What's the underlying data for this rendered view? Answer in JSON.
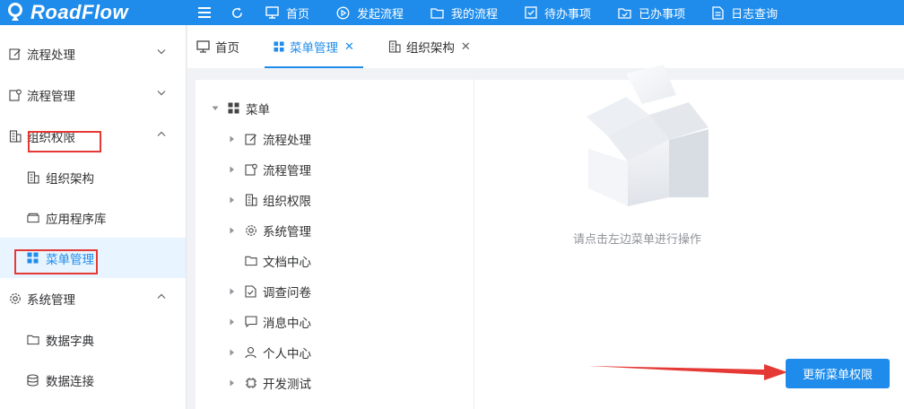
{
  "app": {
    "logo_text": "RoadFlow",
    "brand_color": "#1f8ceb",
    "highlight_color": "#e53935"
  },
  "topnav": [
    {
      "label": "首页",
      "icon": "monitor-icon"
    },
    {
      "label": "发起流程",
      "icon": "play-circle-icon"
    },
    {
      "label": "我的流程",
      "icon": "folder-icon"
    },
    {
      "label": "待办事项",
      "icon": "check-square-icon"
    },
    {
      "label": "已办事项",
      "icon": "folder-check-icon"
    },
    {
      "label": "日志查询",
      "icon": "document-icon"
    }
  ],
  "sidebar": {
    "groups": [
      {
        "label": "流程处理",
        "icon": "edit-icon",
        "expanded": false
      },
      {
        "label": "流程管理",
        "icon": "settings-doc-icon",
        "expanded": false
      },
      {
        "label": "组织权限",
        "icon": "building-icon",
        "expanded": true,
        "children": [
          {
            "label": "组织架构",
            "icon": "building-icon"
          },
          {
            "label": "应用程序库",
            "icon": "window-stack-icon"
          },
          {
            "label": "菜单管理",
            "icon": "grid-icon",
            "active": true
          }
        ]
      },
      {
        "label": "系统管理",
        "icon": "gear-icon",
        "expanded": true,
        "children": [
          {
            "label": "数据字典",
            "icon": "folder-icon"
          },
          {
            "label": "数据连接",
            "icon": "database-icon"
          }
        ]
      }
    ]
  },
  "tabs": [
    {
      "label": "首页",
      "icon": "monitor-icon",
      "closable": false
    },
    {
      "label": "菜单管理",
      "icon": "grid-icon",
      "closable": true,
      "active": true
    },
    {
      "label": "组织架构",
      "icon": "building-icon",
      "closable": true
    }
  ],
  "tree": {
    "root": "菜单",
    "children": [
      {
        "label": "流程处理",
        "icon": "edit-icon",
        "has_children": true
      },
      {
        "label": "流程管理",
        "icon": "settings-doc-icon",
        "has_children": true
      },
      {
        "label": "组织权限",
        "icon": "building-icon",
        "has_children": true
      },
      {
        "label": "系统管理",
        "icon": "gear-icon",
        "has_children": true
      },
      {
        "label": "文档中心",
        "icon": "folder-icon",
        "has_children": false
      },
      {
        "label": "调查问卷",
        "icon": "check-square-icon",
        "has_children": true
      },
      {
        "label": "消息中心",
        "icon": "message-icon",
        "has_children": true
      },
      {
        "label": "个人中心",
        "icon": "user-icon",
        "has_children": true
      },
      {
        "label": "开发测试",
        "icon": "chip-icon",
        "has_children": true
      }
    ]
  },
  "empty_state": {
    "text": "请点击左边菜单进行操作"
  },
  "actions": {
    "update_label": "更新菜单权限"
  }
}
